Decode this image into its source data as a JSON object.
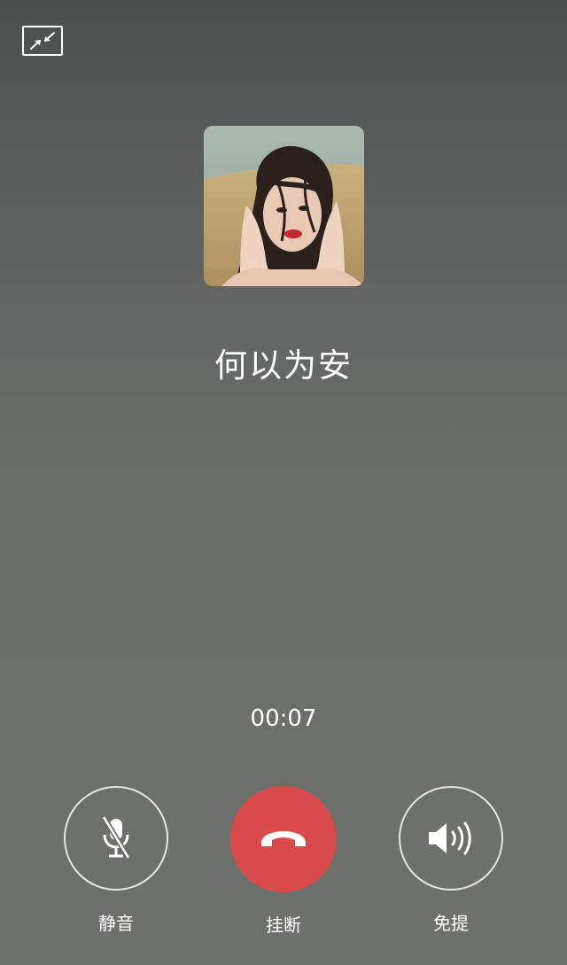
{
  "call": {
    "caller_name": "何以为安",
    "duration": "00:07"
  },
  "icons": {
    "minimize": "minimize-window-icon",
    "avatar": "caller-photo",
    "mute": "microphone-muted-icon",
    "hangup": "phone-hangup-icon",
    "speaker": "speaker-volume-icon"
  },
  "actions": {
    "mute_label": "静音",
    "hangup_label": "挂断",
    "speaker_label": "免提"
  },
  "colors": {
    "hangup": "#d94a4a",
    "background_top": "#4b4f4d",
    "background_bottom": "#6e706d"
  }
}
